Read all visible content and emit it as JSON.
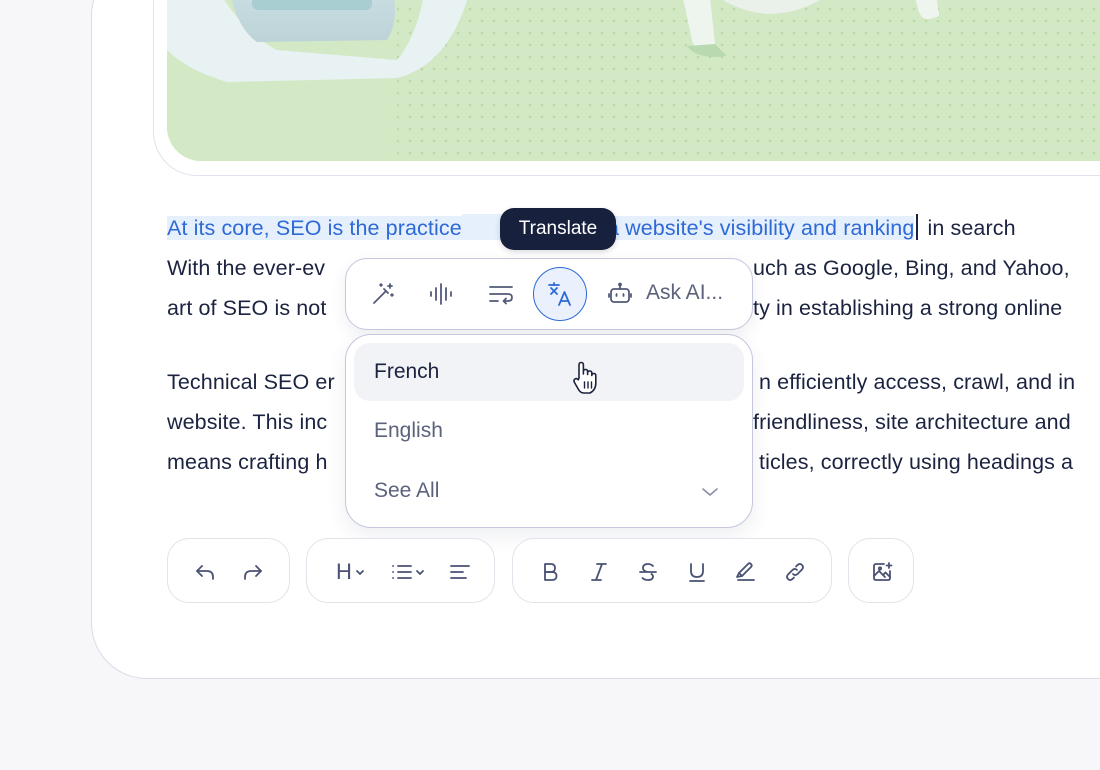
{
  "editor": {
    "paragraph1": {
      "selected_text": "At its core, SEO is the practice of improving a website's visibility and ranking",
      "selected_visible_start": "At its core, SEO is the practice",
      "selected_visible_end": "ng a website's visibility and ranking",
      "after_selection": " in search",
      "line2_left": "With the ever-ev",
      "line2_right": "uch as Google, Bing, and Yahoo,",
      "line3_left": "art of SEO is not",
      "line3_right": "ty in establishing a strong online"
    },
    "paragraph2": {
      "line1_left": "Technical SEO er",
      "line1_right": "n efficiently access, crawl, and in",
      "line2_left": "website. This inc",
      "line2_right": "friendliness, site architecture and",
      "line3_left": "means crafting h",
      "line3_right": "ticles, correctly using headings a"
    }
  },
  "tooltip": {
    "text": "Translate"
  },
  "ai_toolbar": {
    "icons": [
      "magic-wand-icon",
      "voice-wave-icon",
      "text-wrap-icon",
      "translate-icon",
      "robot-icon"
    ],
    "ask_ai_label": "Ask AI..."
  },
  "translate_dropdown": {
    "options": [
      {
        "label": "French",
        "active": true
      },
      {
        "label": "English",
        "active": false
      }
    ],
    "see_all_label": "See All"
  },
  "format_toolbar": {
    "heading_label": "H",
    "groups": [
      [
        "undo-icon",
        "redo-icon"
      ],
      [
        "heading-icon",
        "list-icon",
        "align-icon"
      ],
      [
        "bold-icon",
        "italic-icon",
        "strikethrough-icon",
        "underline-icon",
        "highlight-icon",
        "link-icon"
      ],
      [
        "insert-image-icon"
      ]
    ]
  },
  "colors": {
    "selection_text": "#2d6ad6",
    "selection_bg": "#e6effc",
    "tooltip_bg": "#17213d",
    "body_text": "#1b2340",
    "image_green": "#cfe6c3"
  }
}
